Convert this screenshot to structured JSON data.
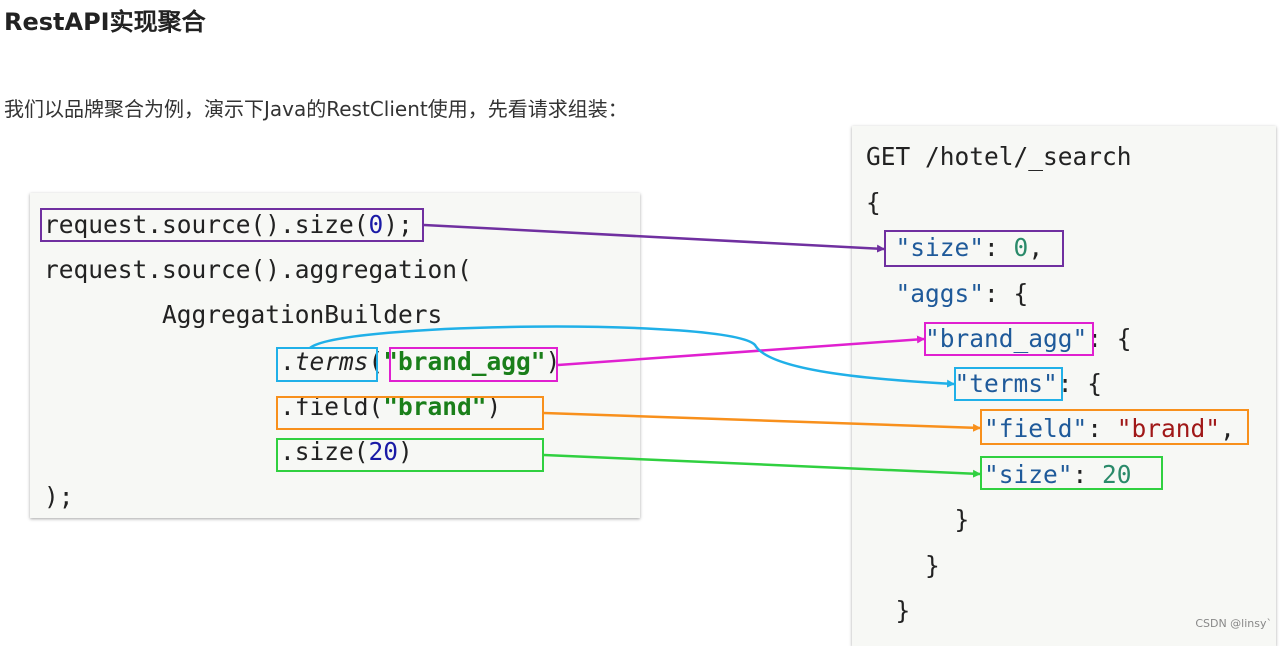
{
  "title": "RestAPI实现聚合",
  "intro": "我们以品牌聚合为例，演示下Java的RestClient使用，先看请求组装：",
  "watermark": "CSDN @linsy`",
  "colors": {
    "purple": "#7030a0",
    "magenta": "#e020d0",
    "cyan": "#20b0e8",
    "orange": "#f8901c",
    "green": "#30d040",
    "key": "#1f5a9a",
    "number": "#2a8a6a",
    "str": "#a01818",
    "java_str": "#1a7f1a",
    "java_num": "#1a1aa6"
  },
  "java_lines": [
    [
      {
        "t": "request.source().size("
      },
      {
        "t": "0",
        "c": "java_num"
      },
      {
        "t": ");"
      }
    ],
    [
      {
        "t": "request.source().aggregation("
      }
    ],
    [
      {
        "t": "        AggregationBuilders"
      }
    ],
    [
      {
        "t": "                .",
        "i": 0
      },
      {
        "t": "terms",
        "i": 1
      },
      {
        "t": "("
      },
      {
        "t": "\"brand_agg\"",
        "c": "java_str",
        "b": 1
      },
      {
        "t": ")"
      }
    ],
    [
      {
        "t": "                .field("
      },
      {
        "t": "\"brand\"",
        "c": "java_str",
        "b": 1
      },
      {
        "t": ")"
      }
    ],
    [
      {
        "t": "                .size("
      },
      {
        "t": "20",
        "c": "java_num"
      },
      {
        "t": ")"
      }
    ],
    [
      {
        "t": ");"
      }
    ]
  ],
  "dsl_lines": [
    [
      {
        "t": "GET /hotel/_search"
      }
    ],
    [
      {
        "t": "{"
      }
    ],
    [
      {
        "t": "  "
      },
      {
        "t": "\"size\"",
        "c": "key"
      },
      {
        "t": ": "
      },
      {
        "t": "0",
        "c": "number"
      },
      {
        "t": ","
      }
    ],
    [
      {
        "t": "  "
      },
      {
        "t": "\"aggs\"",
        "c": "key"
      },
      {
        "t": ": {"
      }
    ],
    [
      {
        "t": "    "
      },
      {
        "t": "\"brand_agg\"",
        "c": "key"
      },
      {
        "t": ": {"
      }
    ],
    [
      {
        "t": "      "
      },
      {
        "t": "\"terms\"",
        "c": "key"
      },
      {
        "t": ": {"
      }
    ],
    [
      {
        "t": "        "
      },
      {
        "t": "\"field\"",
        "c": "key"
      },
      {
        "t": ": "
      },
      {
        "t": "\"brand\"",
        "c": "str"
      },
      {
        "t": ","
      }
    ],
    [
      {
        "t": "        "
      },
      {
        "t": "\"size\"",
        "c": "key"
      },
      {
        "t": ": "
      },
      {
        "t": "20",
        "c": "number"
      }
    ],
    [
      {
        "t": "      }"
      }
    ],
    [
      {
        "t": "    }"
      }
    ],
    [
      {
        "t": "  }"
      }
    ]
  ]
}
